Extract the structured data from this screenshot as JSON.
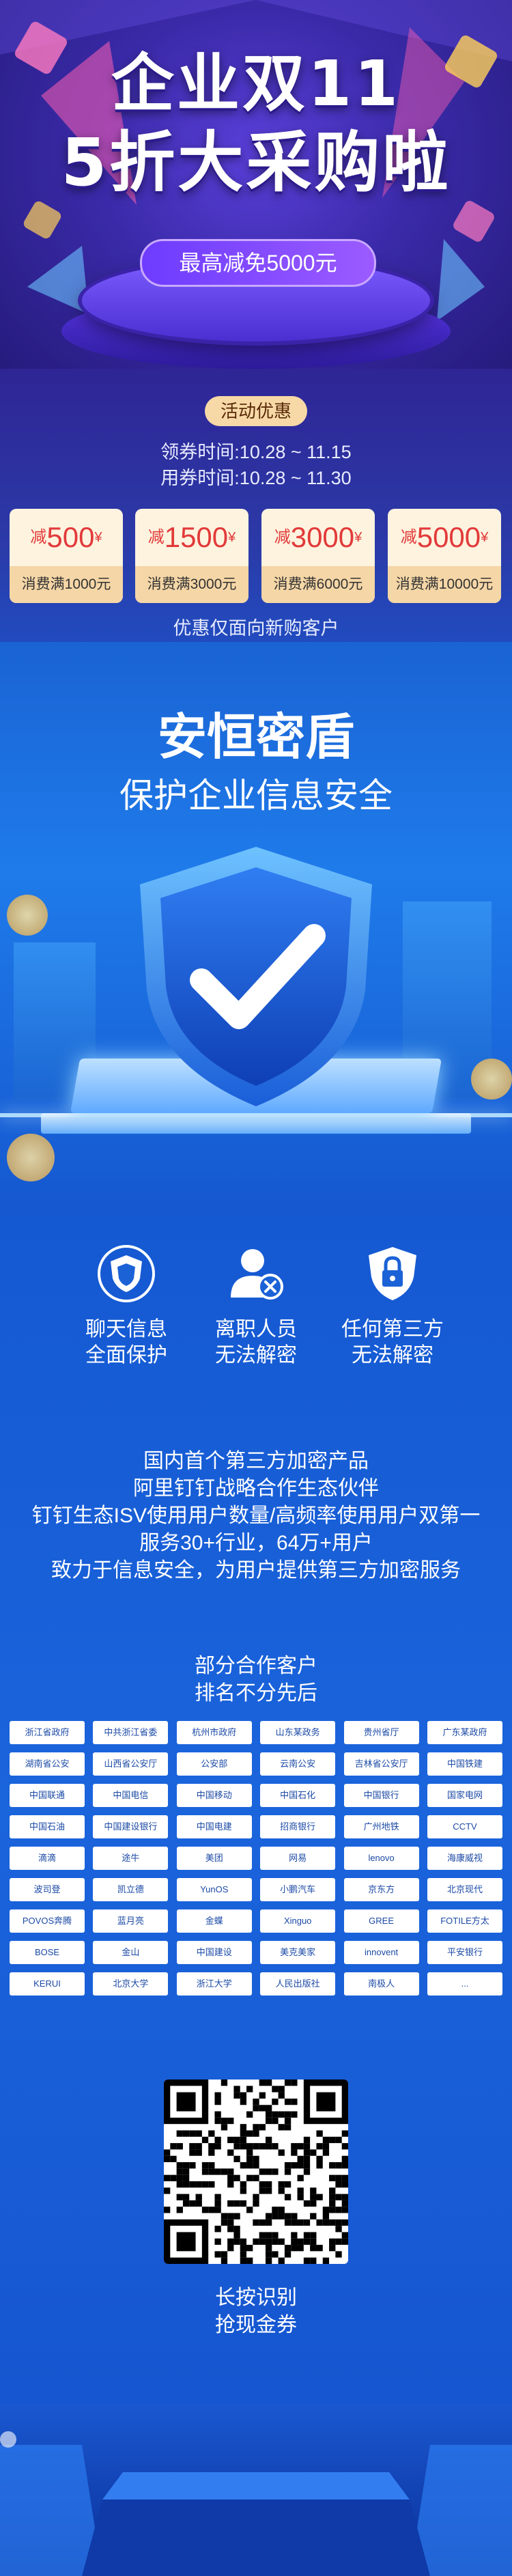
{
  "hero": {
    "title_line1": "企业双11",
    "title_line2": "5折大采购啦",
    "pill": "最高减免5000元"
  },
  "coupons": {
    "badge": "活动优惠",
    "receive_time": "领券时间:10.28 ~ 11.15",
    "use_time": "用券时间:10.28 ~ 11.30",
    "items": [
      {
        "prefix": "减",
        "amount": "500",
        "yen": "¥",
        "condition": "消费满1000元"
      },
      {
        "prefix": "减",
        "amount": "1500",
        "yen": "¥",
        "condition": "消费满3000元"
      },
      {
        "prefix": "减",
        "amount": "3000",
        "yen": "¥",
        "condition": "消费满6000元"
      },
      {
        "prefix": "减",
        "amount": "5000",
        "yen": "¥",
        "condition": "消费满10000元"
      }
    ],
    "note": "优惠仅面向新购客户"
  },
  "product": {
    "title": "安恒密盾",
    "subtitle": "保护企业信息安全"
  },
  "features": [
    {
      "icon": "chat-shield-icon",
      "line1": "聊天信息",
      "line2": "全面保护"
    },
    {
      "icon": "user-x-icon",
      "line1": "离职人员",
      "line2": "无法解密"
    },
    {
      "icon": "lock-shield-icon",
      "line1": "任何第三方",
      "line2": "无法解密"
    }
  ],
  "description": {
    "lines": [
      "国内首个第三方加密产品",
      "阿里钉钉战略合作生态伙伴",
      "钉钉生态ISV使用用户数量/高频率使用用户双第一",
      "服务30+行业，64万+用户",
      "致力于信息安全，为用户提供第三方加密服务"
    ]
  },
  "clients": {
    "title_line1": "部分合作客户",
    "title_line2": "排名不分先后",
    "logos": [
      "浙江省政府",
      "中共浙江省委",
      "杭州市政府",
      "山东某政务",
      "贵州省厅",
      "广东某政府",
      "湖南省公安",
      "山西省公安厅",
      "公安部",
      "云南公安",
      "吉林省公安厅",
      "中国铁建",
      "中国联通",
      "中国电信",
      "中国移动",
      "中国石化",
      "中国银行",
      "国家电网",
      "中国石油",
      "中国建设银行",
      "中国电建",
      "招商银行",
      "广州地铁",
      "CCTV",
      "滴滴",
      "途牛",
      "美团",
      "网易",
      "lenovo",
      "海康威视",
      "波司登",
      "凯立德",
      "YunOS",
      "小鹏汽车",
      "京东方",
      "北京现代",
      "POVOS奔腾",
      "蓝月亮",
      "金蝶",
      "Xinguo",
      "GREE",
      "FOTILE方太",
      "BOSE",
      "金山",
      "中国建设",
      "美克美家",
      "innovent",
      "平安银行",
      "KERUI",
      "北京大学",
      "浙江大学",
      "人民出版社",
      "南极人",
      "..."
    ]
  },
  "qr": {
    "caption_line1": "长按识别",
    "caption_line2": "抢现金券"
  }
}
